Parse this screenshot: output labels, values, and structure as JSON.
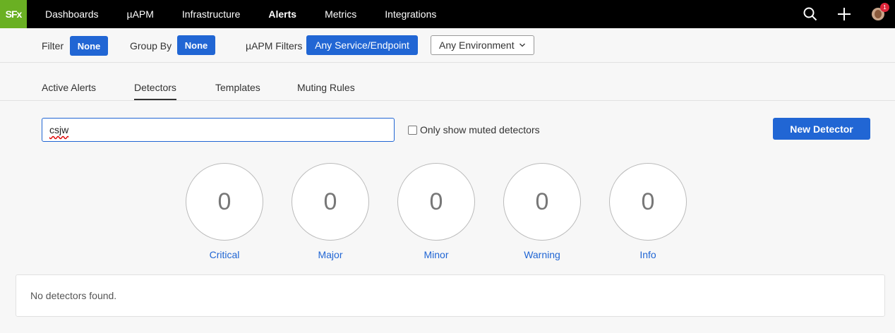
{
  "logo": "SFx",
  "nav": {
    "items": [
      {
        "label": "Dashboards",
        "active": false
      },
      {
        "label": "µAPM",
        "active": false
      },
      {
        "label": "Infrastructure",
        "active": false
      },
      {
        "label": "Alerts",
        "active": true
      },
      {
        "label": "Metrics",
        "active": false
      },
      {
        "label": "Integrations",
        "active": false
      }
    ],
    "notification_count": "1"
  },
  "filterbar": {
    "filter_label": "Filter",
    "filter_value": "None",
    "groupby_label": "Group By",
    "groupby_value": "None",
    "apm_filters_label": "µAPM Filters",
    "apm_filters_value": "Any Service/Endpoint",
    "environment_value": "Any Environment"
  },
  "tabs": [
    "Active Alerts",
    "Detectors",
    "Templates",
    "Muting Rules"
  ],
  "active_tab": "Detectors",
  "search": {
    "value": "csjw"
  },
  "muted_checkbox": {
    "label": "Only show muted detectors",
    "checked": false
  },
  "new_detector_label": "New Detector",
  "severities": [
    {
      "label": "Critical",
      "count": "0"
    },
    {
      "label": "Major",
      "count": "0"
    },
    {
      "label": "Minor",
      "count": "0"
    },
    {
      "label": "Warning",
      "count": "0"
    },
    {
      "label": "Info",
      "count": "0"
    }
  ],
  "results_message": "No detectors found.",
  "colors": {
    "accent": "#2166d4",
    "logo": "#6ab023",
    "nav_bg": "#000000",
    "badge": "#e0263a"
  }
}
